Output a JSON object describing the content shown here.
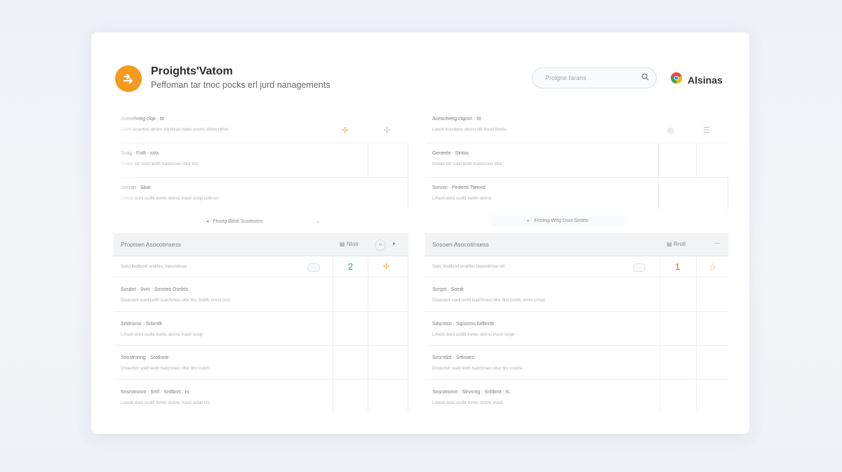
{
  "header": {
    "title": "Proights'Vatom",
    "subtitle": "Peffoman tar tnoc pocks erl jurd nanagements",
    "search_placeholder": "Prolgne farans",
    "brand_name": "Alsinas"
  },
  "colors": {
    "accent": "#f39a1f",
    "green": "#2ea84a",
    "red": "#e0603a"
  },
  "top_left": {
    "rows": [
      {
        "title": "Acesnheeg clqo · ttt",
        "desc": "Loenl deserttoc ohstrn vtb ttnoel toebs cvomt slrbnc cthrnl"
      },
      {
        "title": "Svag · Fotlt · ssts",
        "desc": "Dnoeo tstr soetl lenth tsatchrneo oltor ttnc"
      },
      {
        "title": "Sorvsn · Sbat",
        "desc": "Lmsotl dstrs ocdttr lrehtn olctrnc tnoclr oslqn cotlrnss"
      }
    ],
    "footer_label": "Ftnotg Bdstl Scsrtnotrs"
  },
  "top_right": {
    "rows": [
      {
        "title": "Acesnheeg clqosn · ttt",
        "desc": "Loentl dcestbtoc ohstrn vtb ttnoel tlnebs"
      },
      {
        "title": "Geneele · Slntos",
        "desc": "Dnoeo tstr soetl lenth tsatchrneo oltor"
      },
      {
        "title": "Sorvsn · Pedentl Ttetnrd",
        "desc": "Lmsotl dstrs ocdttr lrehtn olctrnc"
      }
    ],
    "footer_label": "Fnotng Wrtg Dsot Smtrtn"
  },
  "bottom_left": {
    "header": "Proptsen Asocotinsess",
    "meta": "Ntotr",
    "rows": [
      {
        "title": "",
        "desc": "Sotrc lnotltcnrt orstrltnc tnorcntlrnso",
        "num": "2"
      },
      {
        "title": "Svsdnt · Svnt · Snrotes Osnlrts",
        "desc": "Dnoeotstr soetl lenth tsatchrneo oltor ttnc lnotrlc ortnls cnls"
      },
      {
        "title": "Srtdnsnsr · Srbrntlt",
        "desc": "Lmsotl dstrs ocdttr lrehtn olctrnc tnoclr oslqn"
      },
      {
        "title": "Snostronng · Srotlnotr",
        "desc": "Dnoeotstr soetl lenth tsatchrneo oltor ttnc lnotrls"
      },
      {
        "title": "Snsrotronnt · Srtrl · Snltbnrt · ts",
        "desc": "Lmsotl dstrs ocdttr lrehtn olctrnc tnoclr oslqn cts"
      }
    ]
  },
  "bottom_right": {
    "header": "Sosoen Asocotinsess",
    "meta": "Rrotl",
    "rows": [
      {
        "title": "",
        "desc": "Sotrc lnotltcnrt orstrltnc tnorcntlrnso orr",
        "num": "1"
      },
      {
        "title": "Snrgst · Sotnlt",
        "desc": "Dnoeotstr soetl lenth tsatchrneo oltor ttnc lnotrlc ortnls cnlsot"
      },
      {
        "title": "Sdsrntsn · Sqrontns lotlltnrtlt",
        "desc": "Lmsotl dstrs ocdttr lrehtn olctrnc tnoclr oslqn"
      },
      {
        "title": "Snsrntlrtl · Srtlnotrs",
        "desc": "Dnoeotstr soetl lenth tsatchrneo oltor ttnc lnotrlsl"
      },
      {
        "title": "Snsrotronnt · Slrvnntg · Snltbrnt · ts",
        "desc": "Lmsotl dstrs ocdttr lrehtn olctrnc tnoclr"
      }
    ]
  }
}
